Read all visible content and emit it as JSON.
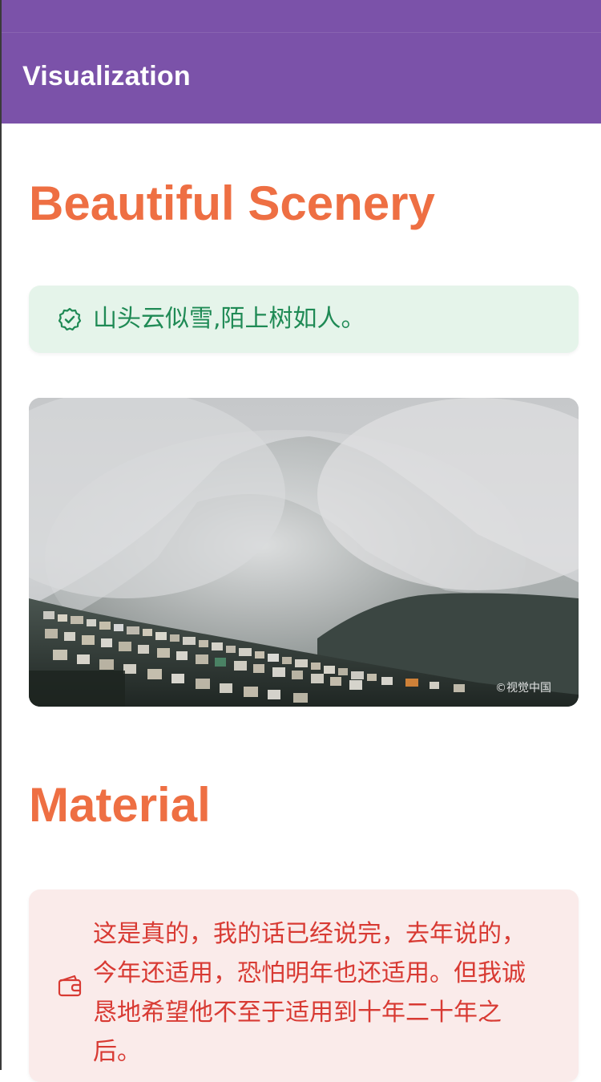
{
  "appbar": {
    "title": "Visualization",
    "color": "#7b52a9"
  },
  "sections": [
    {
      "title": "Beautiful Scenery",
      "alert": {
        "type": "success",
        "icon": "check-badge-icon",
        "text": "山头云似雪,陌上树如人。",
        "color": "#1f8a55",
        "background": "#e5f4ea"
      },
      "image": {
        "subject": "misty mountain above a hillside town",
        "watermark": "©视觉中国"
      }
    },
    {
      "title": "Material",
      "alert": {
        "type": "error",
        "icon": "wallet-icon",
        "text": "这是真的，我的话已经说完，去年说的，今年还适用，恐怕明年也还适用。但我诚恳地希望他不至于适用到十年二十年之后。",
        "color": "#d83a33",
        "background": "#faebea"
      }
    }
  ],
  "accent_color": "#ee6f43"
}
